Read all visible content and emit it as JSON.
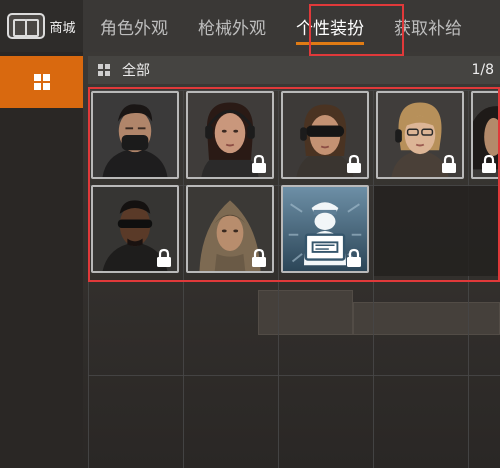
{
  "shop": {
    "label": "商城",
    "icon": "shop-icon"
  },
  "tabs": [
    {
      "label": "角色外观",
      "active": false
    },
    {
      "label": "枪械外观",
      "active": false
    },
    {
      "label": "个性装扮",
      "active": true
    },
    {
      "label": "获取补给",
      "active": false
    }
  ],
  "sidebar": {
    "items": [
      {
        "icon": "grid-icon",
        "active": true
      }
    ]
  },
  "category": {
    "label": "全部",
    "page": "1/8"
  },
  "items": [
    {
      "name": "masked-man-portrait",
      "locked": false
    },
    {
      "name": "dark-haired-woman-headset-portrait",
      "locked": true
    },
    {
      "name": "woman-goggles-portrait",
      "locked": true
    },
    {
      "name": "blonde-woman-glasses-portrait",
      "locked": true
    },
    {
      "name": "partial-portrait",
      "locked": true
    },
    {
      "name": "man-sunglasses-portrait",
      "locked": true
    },
    {
      "name": "hooded-man-portrait",
      "locked": true
    },
    {
      "name": "delivery-box-icon",
      "locked": true
    }
  ],
  "colors": {
    "accent": "#d9690f",
    "highlight": "#e0393a",
    "tab_underline": "#e07b14"
  }
}
